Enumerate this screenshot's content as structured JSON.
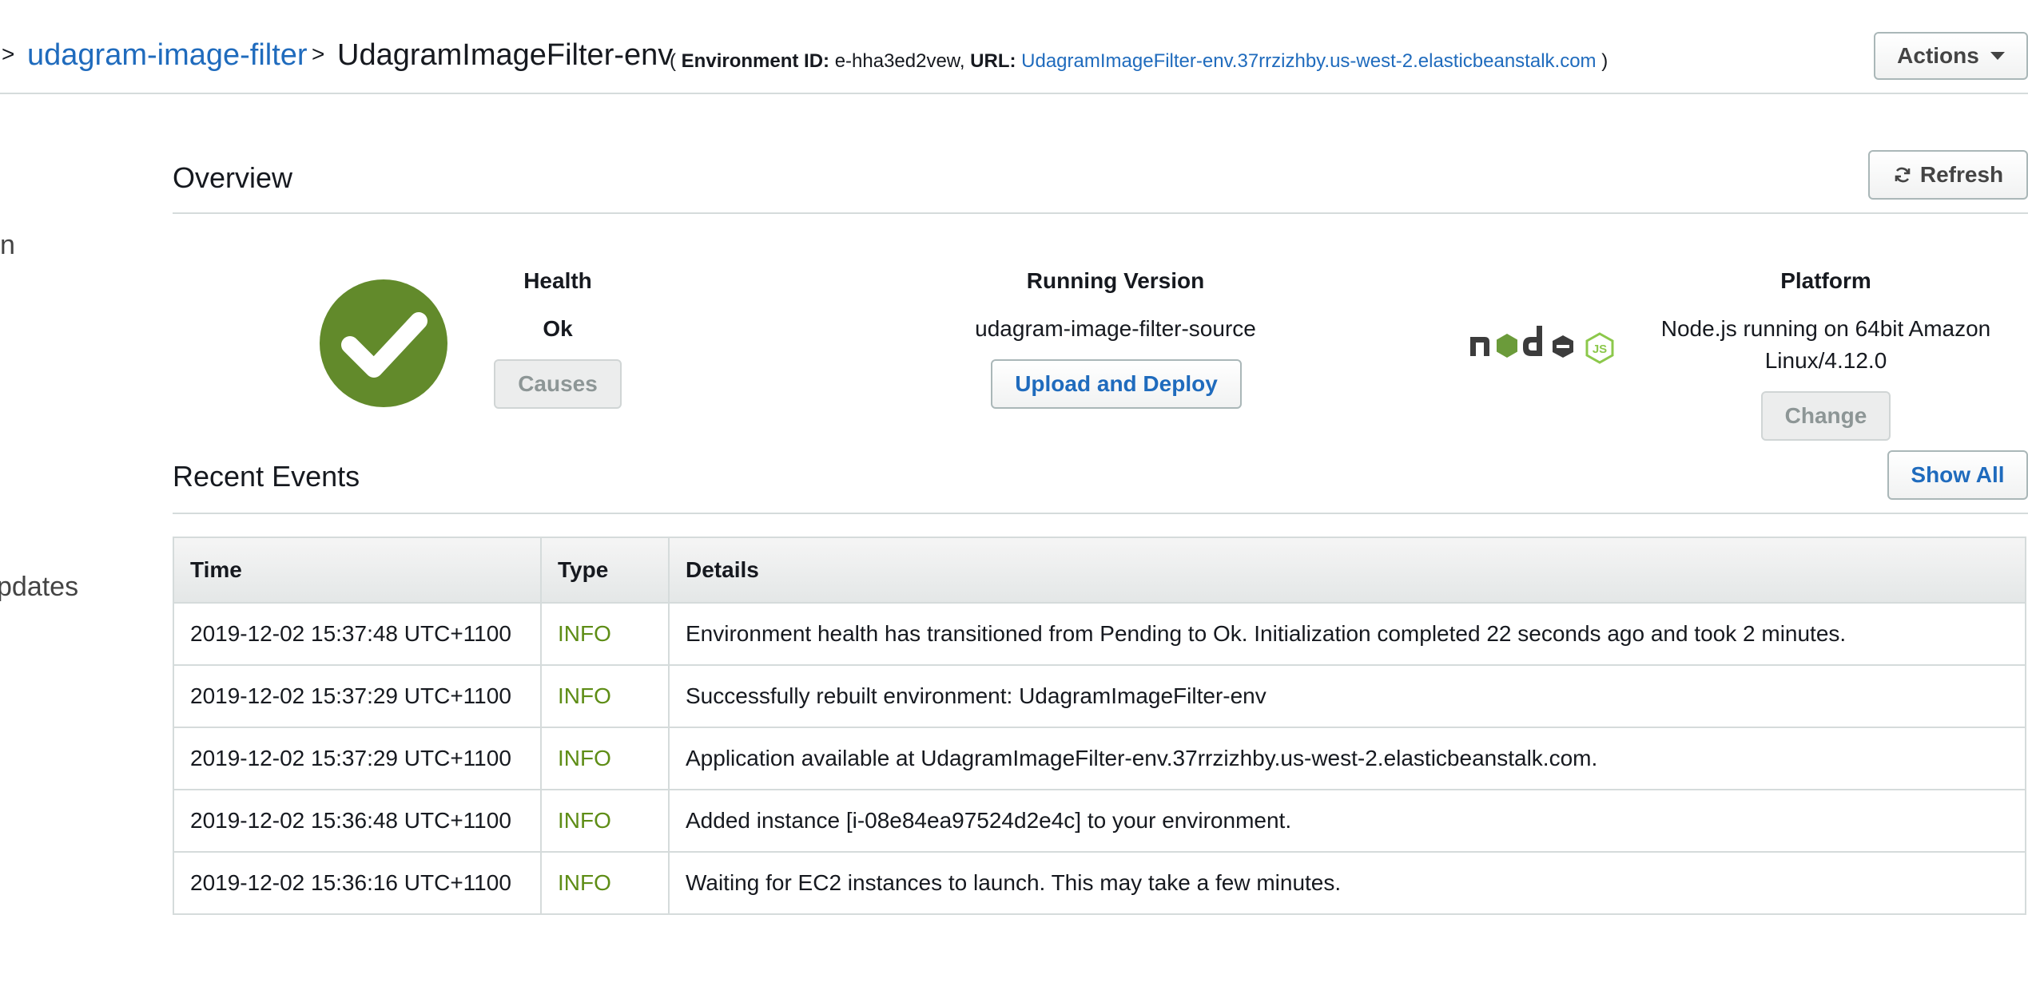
{
  "breadcrumb": {
    "application": "udagram-image-filter",
    "environment": "UdagramImageFilter-env",
    "env_id_label": "Environment ID:",
    "env_id": "e-hha3ed2vew,",
    "url_label": "URL:",
    "url": "UdagramImageFilter-env.37rrzizhby.us-west-2.elasticbeanstalk.com",
    "open_paren": "(",
    "close_paren": ")"
  },
  "actions_label": "Actions",
  "sidebar_fragments": [
    "n",
    "pdates"
  ],
  "overview": {
    "title": "Overview",
    "refresh_label": "Refresh",
    "health": {
      "label": "Health",
      "value": "Ok",
      "causes_label": "Causes"
    },
    "running_version": {
      "label": "Running Version",
      "value": "udagram-image-filter-source",
      "deploy_label": "Upload and Deploy"
    },
    "platform": {
      "label": "Platform",
      "value_line1": "Node.js running on 64bit Amazon",
      "value_line2": "Linux/4.12.0",
      "change_label": "Change"
    }
  },
  "recent_events": {
    "title": "Recent Events",
    "show_all_label": "Show All",
    "columns": [
      "Time",
      "Type",
      "Details"
    ],
    "rows": [
      {
        "time": "2019-12-02 15:37:48 UTC+1100",
        "type": "INFO",
        "details": "Environment health has transitioned from Pending to Ok. Initialization completed 22 seconds ago and took 2 minutes."
      },
      {
        "time": "2019-12-02 15:37:29 UTC+1100",
        "type": "INFO",
        "details": "Successfully rebuilt environment: UdagramImageFilter-env"
      },
      {
        "time": "2019-12-02 15:37:29 UTC+1100",
        "type": "INFO",
        "details": "Application available at UdagramImageFilter-env.37rrzizhby.us-west-2.elasticbeanstalk.com."
      },
      {
        "time": "2019-12-02 15:36:48 UTC+1100",
        "type": "INFO",
        "details": "Added instance [i-08e84ea97524d2e4c] to your environment."
      },
      {
        "time": "2019-12-02 15:36:16 UTC+1100",
        "type": "INFO",
        "details": "Waiting for EC2 instances to launch. This may take a few minutes."
      }
    ]
  },
  "colors": {
    "link": "#1f6bbd",
    "health_ok": "#628a2b",
    "info": "#5e8d16",
    "border": "#d5dbdb"
  },
  "icons": {
    "health": "check-circle-icon",
    "refresh": "refresh-icon",
    "actions": "caret-down-icon",
    "platform": "nodejs-logo"
  }
}
